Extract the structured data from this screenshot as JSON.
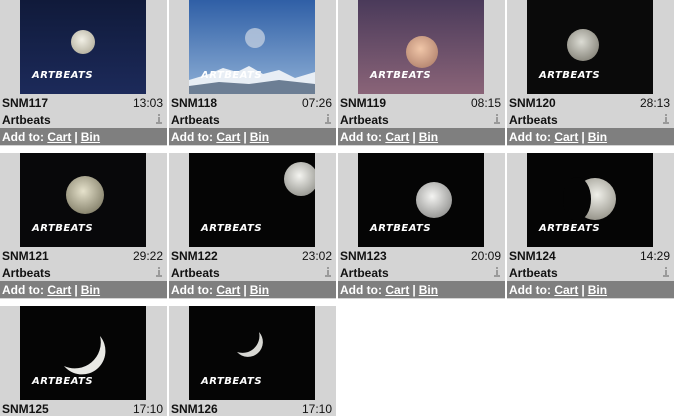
{
  "add_label": "Add to:",
  "cart_label": "Cart",
  "bin_label": "Bin",
  "separator": "|",
  "watermark": "ARTBEATS",
  "clips": [
    {
      "code": "SNM117",
      "duration": "13:03",
      "vendor": "Artbeats"
    },
    {
      "code": "SNM118",
      "duration": "07:26",
      "vendor": "Artbeats"
    },
    {
      "code": "SNM119",
      "duration": "08:15",
      "vendor": "Artbeats"
    },
    {
      "code": "SNM120",
      "duration": "28:13",
      "vendor": "Artbeats"
    },
    {
      "code": "SNM121",
      "duration": "29:22",
      "vendor": "Artbeats"
    },
    {
      "code": "SNM122",
      "duration": "23:02",
      "vendor": "Artbeats"
    },
    {
      "code": "SNM123",
      "duration": "20:09",
      "vendor": "Artbeats"
    },
    {
      "code": "SNM124",
      "duration": "14:29",
      "vendor": "Artbeats"
    },
    {
      "code": "SNM125",
      "duration": "17:10",
      "vendor": "Artbeats"
    },
    {
      "code": "SNM126",
      "duration": "17:10",
      "vendor": "Artbeats"
    }
  ]
}
